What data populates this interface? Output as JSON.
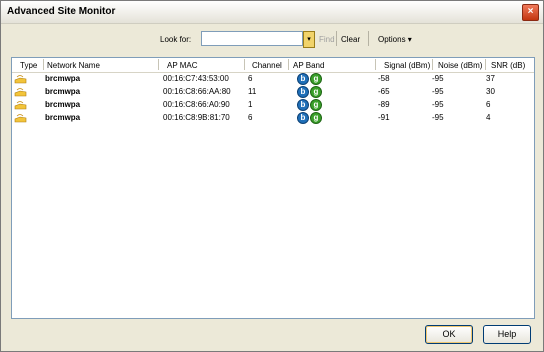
{
  "window": {
    "title": "Advanced Site Monitor",
    "close": "×"
  },
  "toolbar": {
    "look_for_label": "Look for:",
    "search_value": "",
    "dropdown_glyph": "▾",
    "find_label": "Find",
    "clear_label": "Clear",
    "options_label": "Options ▾"
  },
  "table": {
    "columns": [
      "Type",
      "Network Name",
      "AP MAC",
      "Channel",
      "AP Band",
      "Signal (dBm)",
      "Noise (dBm)",
      "SNR (dB)"
    ],
    "rows": [
      {
        "name": "brcmwpa",
        "mac": "00:16:C7:43:53:00",
        "channel": "6",
        "band_b": "b",
        "band_g": "g",
        "signal": "-58",
        "noise": "-95",
        "snr": "37"
      },
      {
        "name": "brcmwpa",
        "mac": "00:16:C8:66:AA:80",
        "channel": "11",
        "band_b": "b",
        "band_g": "g",
        "signal": "-65",
        "noise": "-95",
        "snr": "30"
      },
      {
        "name": "brcmwpa",
        "mac": "00:16:C8:66:A0:90",
        "channel": "1",
        "band_b": "b",
        "band_g": "g",
        "signal": "-89",
        "noise": "-95",
        "snr": "6"
      },
      {
        "name": "brcmwpa",
        "mac": "00:16:C8:9B:81:70",
        "channel": "6",
        "band_b": "b",
        "band_g": "g",
        "signal": "-91",
        "noise": "-95",
        "snr": "4"
      }
    ]
  },
  "buttons": {
    "ok": "OK",
    "help": "Help"
  },
  "colors": {
    "band_b": "#1f6fb8",
    "band_g": "#3aa02a",
    "window_bg": "#ece9d8"
  }
}
